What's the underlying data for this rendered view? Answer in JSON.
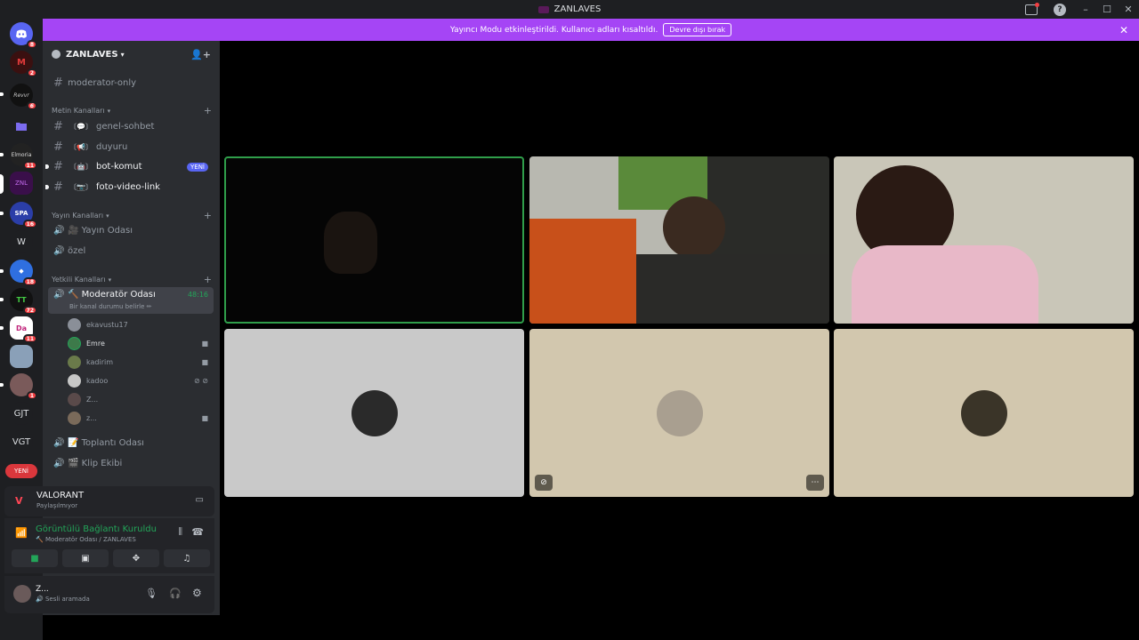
{
  "window": {
    "title": "ZANLAVES",
    "minimize": "–",
    "maximize": "☐",
    "close": "✕",
    "help": "?"
  },
  "banner": {
    "text": "Yayıncı Modu etkinleştirildi. Kullanıcı adları kısaltıldı.",
    "button": "Devre dışı bırak",
    "close": "✕"
  },
  "guilds": {
    "badges": [
      "8",
      "2",
      "6",
      "11",
      "16",
      "18",
      "72",
      "11",
      "1"
    ],
    "texts": {
      "w": "W",
      "gjt": "GJT",
      "vgt": "VGT"
    },
    "new_label": "YENİ"
  },
  "server": {
    "name": "ZANLAVES"
  },
  "channels": {
    "top": "moderator-only",
    "cat_text": "Metin Kanalları",
    "text": [
      {
        "tag": "〔💬〕",
        "name": "genel-sohbet"
      },
      {
        "tag": "〔📢〕",
        "name": "duyuru"
      },
      {
        "tag": "〔🤖〕",
        "name": "bot-komut",
        "badge": "YENİ"
      },
      {
        "tag": "〔📷〕",
        "name": "foto-video-link"
      }
    ],
    "cat_stream": "Yayın Kanalları",
    "stream": [
      {
        "name": "🎥 Yayın Odası"
      },
      {
        "name": "özel"
      }
    ],
    "cat_staff": "Yetkili Kanalları",
    "active": {
      "name": "🔨 Moderatör Odası",
      "time": "48:16",
      "status": "Bir kanal durumu belirle ✏"
    },
    "members": [
      {
        "name": "ekavustu17"
      },
      {
        "name": "Emre"
      },
      {
        "name": "kadirim"
      },
      {
        "name": "kadoo"
      },
      {
        "name": "Z..."
      },
      {
        "name": "z..."
      }
    ],
    "after": [
      {
        "name": "📝 Toplantı Odası"
      },
      {
        "name": "🎬 Klip Ekibi"
      }
    ]
  },
  "activity": {
    "game": "VALORANT",
    "status": "Paylaşılmıyor"
  },
  "voice": {
    "title": "Görüntülü Bağlantı Kuruldu",
    "sub": "🔨 Moderatör Odası / ZANLAVES"
  },
  "user": {
    "name": "Z...",
    "status": "🔊 Sesli aramada"
  },
  "colors": {
    "accent": "#a545f5",
    "connected": "#23a559",
    "badge": "#f23f43",
    "blurple": "#5865f2"
  }
}
